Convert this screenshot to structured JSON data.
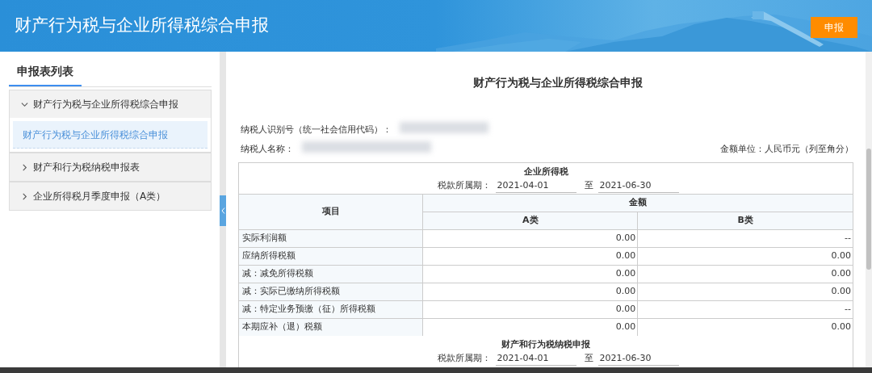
{
  "header": {
    "title": "财产行为税与企业所得税综合申报",
    "submit_button": "申报"
  },
  "sidebar": {
    "title": "申报表列表",
    "groups": [
      {
        "label": "财产行为税与企业所得税综合申报",
        "expanded": true,
        "children": [
          {
            "label": "财产行为税与企业所得税综合申报",
            "selected": true
          }
        ]
      },
      {
        "label": "财产和行为税纳税申报表",
        "expanded": false
      },
      {
        "label": "企业所得税月季度申报（A类）",
        "expanded": false
      }
    ]
  },
  "document": {
    "title": "财产行为税与企业所得税综合申报",
    "taxpayer_id_label": "纳税人识别号（统一社会信用代码）：",
    "taxpayer_name_label": "纳税人名称：",
    "unit_note": "金额单位：人民币元（列至角分）",
    "sections": [
      {
        "title": "企业所得税",
        "period_label": "税款所属期：",
        "period_start": "2021-04-01",
        "to_label": "至",
        "period_end": "2021-06-30",
        "item_header": "项目",
        "amount_header": "金额",
        "sub_headers": [
          "A类",
          "B类"
        ],
        "rows": [
          {
            "item": "实际利润额",
            "a": "0.00",
            "b": "--"
          },
          {
            "item": "应纳所得税额",
            "a": "0.00",
            "b": "0.00"
          },
          {
            "item": "减：减免所得税额",
            "a": "0.00",
            "b": "0.00"
          },
          {
            "item": "减：实际已缴纳所得税额",
            "a": "0.00",
            "b": "0.00"
          },
          {
            "item": "减：特定业务预缴（征）所得税额",
            "a": "0.00",
            "b": "--"
          },
          {
            "item": "本期应补（退）税额",
            "a": "0.00",
            "b": "0.00"
          }
        ]
      },
      {
        "title": "财产和行为税纳税申报",
        "period_label": "税款所属期：",
        "period_start": "2021-04-01",
        "to_label": "至",
        "period_end": "2021-06-30"
      }
    ]
  }
}
